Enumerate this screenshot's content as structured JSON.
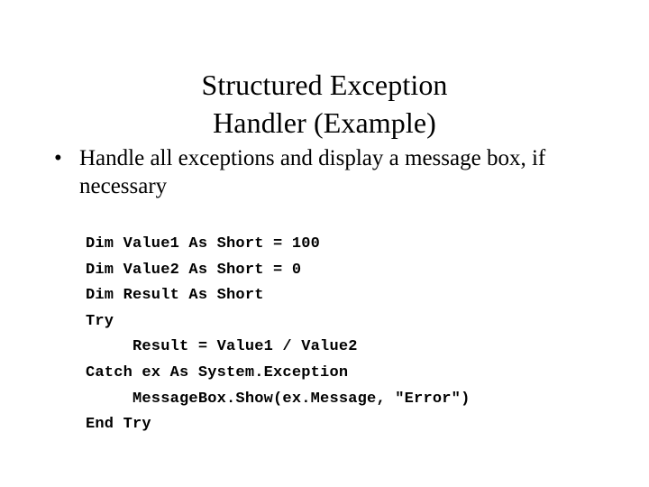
{
  "slide": {
    "background_color": "#ffffff",
    "text_color": "#000000",
    "title": {
      "line1": "Structured Exception",
      "line2": "Handler (Example)",
      "full": "Structured Exception Handler (Example)"
    },
    "bullets": [
      {
        "marker": "•",
        "text": "Handle all exceptions and display a message box, if necessary"
      }
    ],
    "code": {
      "language": "Visual Basic .NET",
      "lines": [
        "Dim Value1 As Short = 100",
        "Dim Value2 As Short = 0",
        "Dim Result As Short",
        "Try",
        "     Result = Value1 / Value2",
        "Catch ex As System.Exception",
        "     MessageBox.Show(ex.Message, \"Error\")",
        "End Try"
      ]
    }
  }
}
